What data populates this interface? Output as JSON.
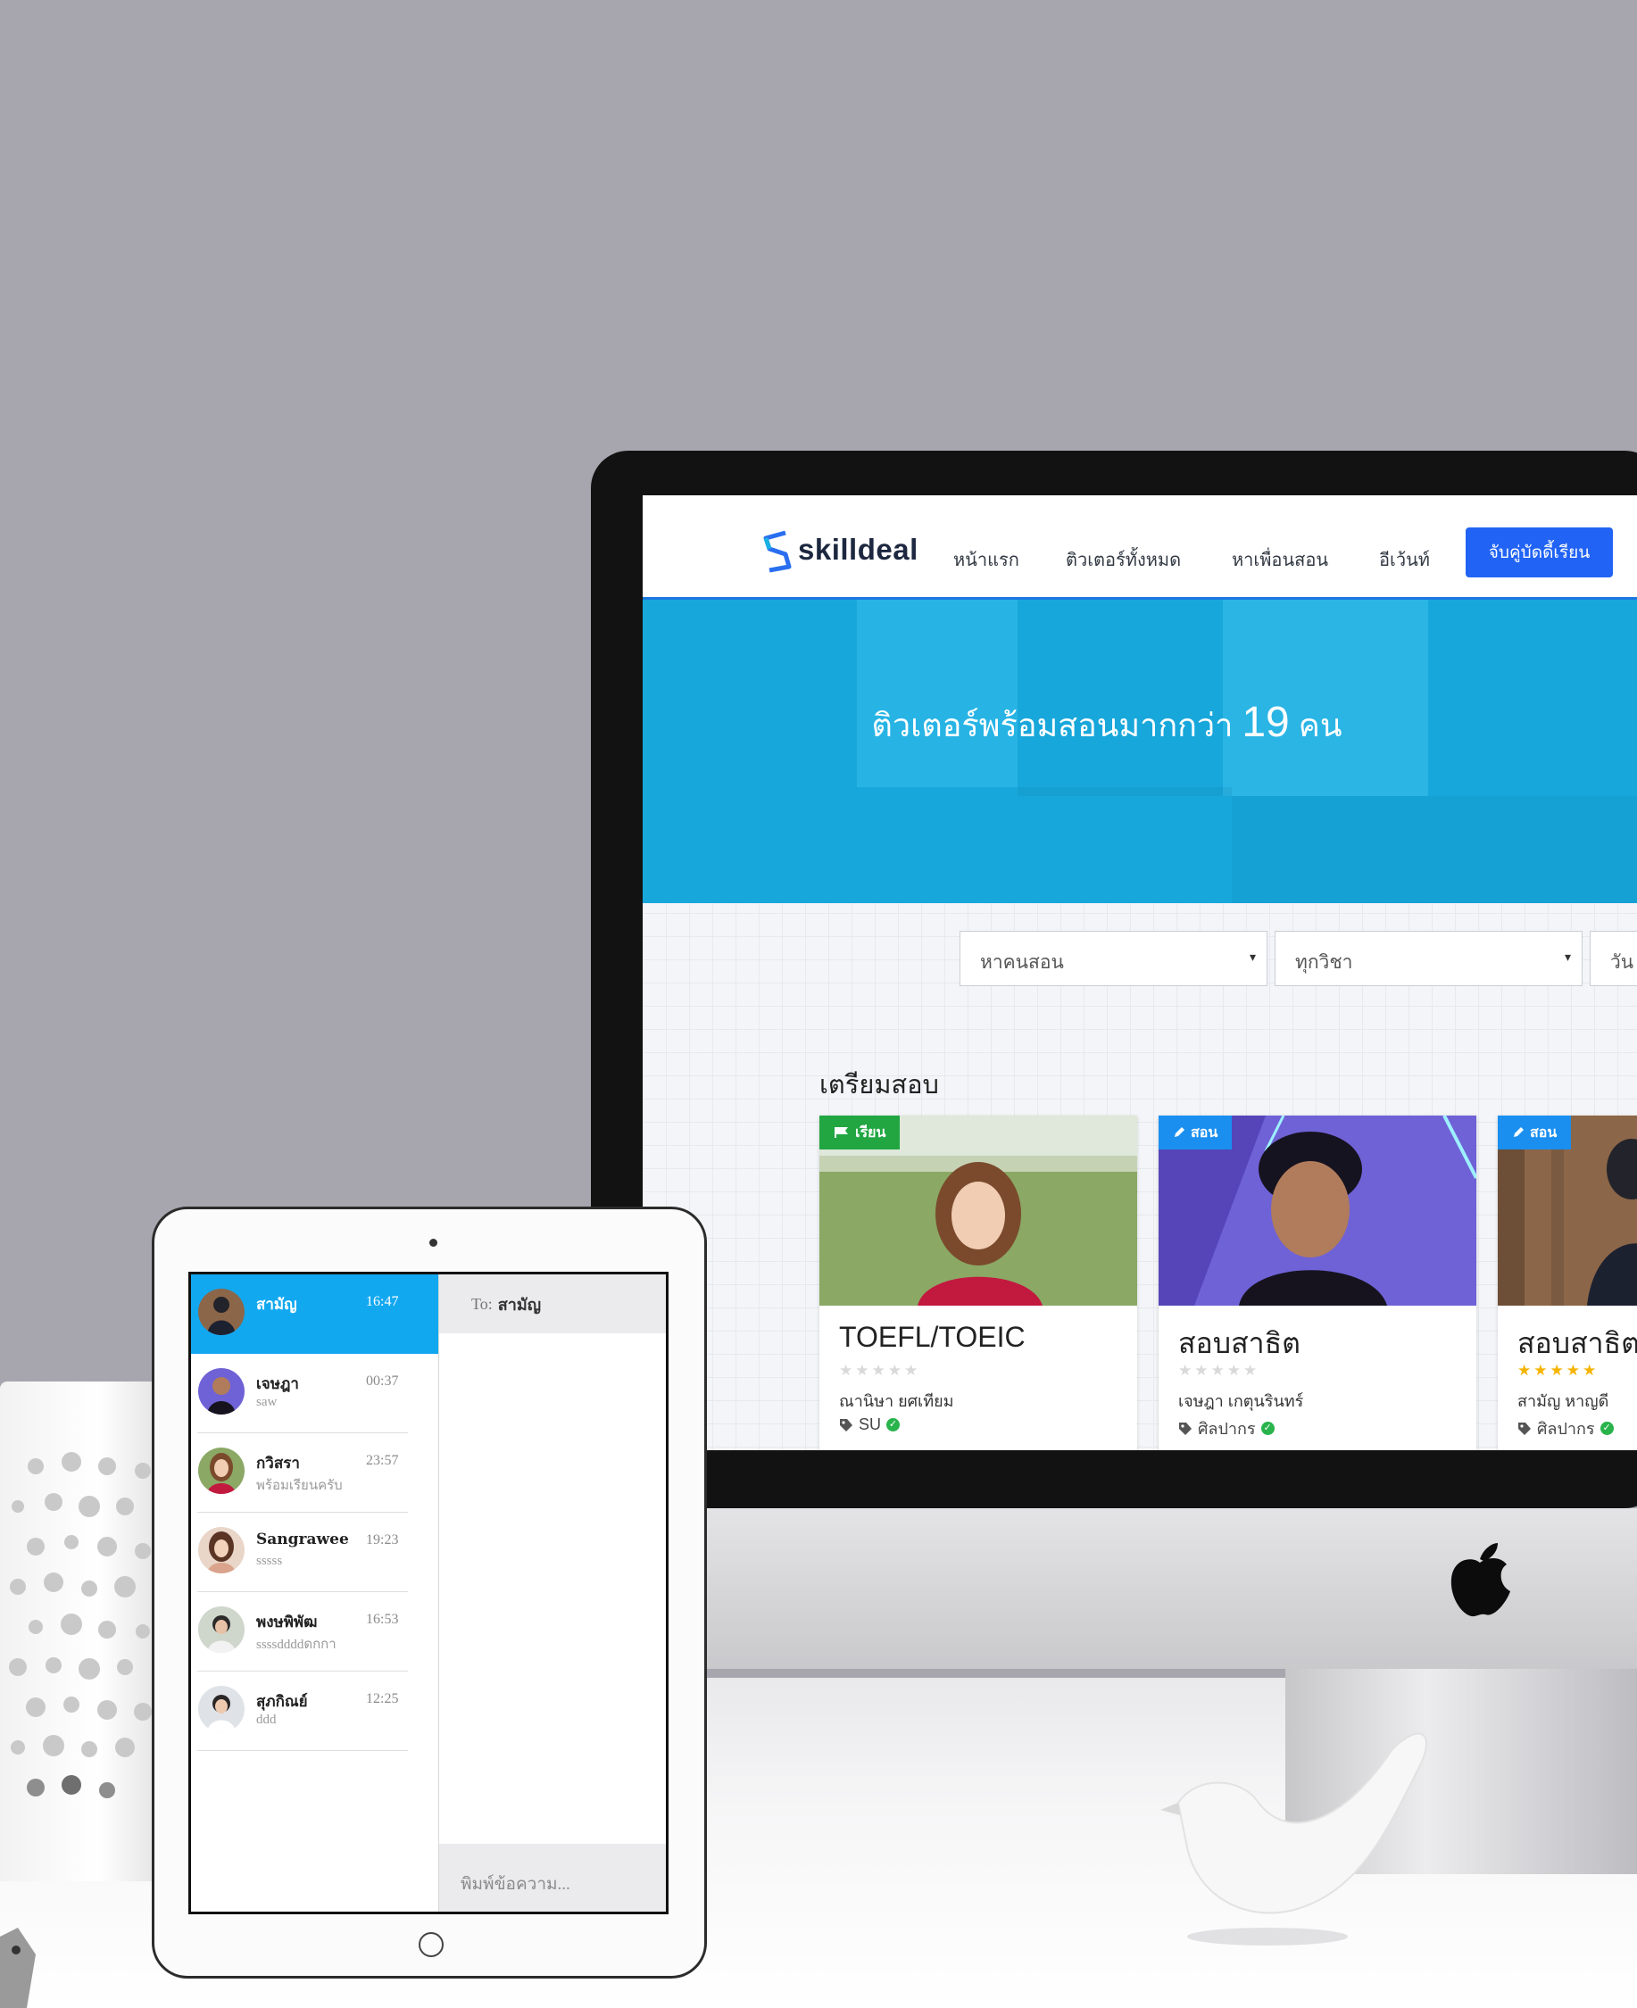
{
  "site": {
    "brand": "skilldeal",
    "nav": [
      "หน้าแรก",
      "ติวเตอร์ทั้งหมด",
      "หาเพื่อนสอน",
      "อีเว้นท์"
    ],
    "cta": "จับคู่บัดดี้เรียน",
    "hero": {
      "prefix": "ติวเตอร์พร้อมสอนมากกว่า ",
      "count": "19",
      "suffix": " คน"
    },
    "filters": [
      {
        "value": "หาคนสอน",
        "caret": "▾"
      },
      {
        "value": "ทุกวิชา",
        "caret": "▾"
      },
      {
        "value": "วัน",
        "caret": ""
      }
    ],
    "section_title": "เตรียมสอบ",
    "cards": [
      {
        "badge": "เรียน",
        "badge_icon": "flag-icon",
        "badge_color": "#21a642",
        "title": "TOEFL/TOEIC",
        "stars": "★★★★★",
        "rating": 0,
        "tutor": "ณานิษา ยศเทียม",
        "university": "SU",
        "verified": "✓"
      },
      {
        "badge": "สอน",
        "badge_icon": "pencil-icon",
        "badge_color": "#1a8ff0",
        "title": "สอบสาธิต",
        "stars": "★★★★★",
        "rating": 0,
        "tutor": "เจษฎา เกตุนรินทร์",
        "university": "ศิลปากร",
        "verified": "✓"
      },
      {
        "badge": "สอน",
        "badge_icon": "pencil-icon",
        "badge_color": "#1a8ff0",
        "title": "สอบสาธิต",
        "stars": "★★★★★",
        "rating": 5,
        "tutor": "สามัญ หาญดี",
        "university": "ศิลปากร",
        "verified": "✓"
      }
    ]
  },
  "chat": {
    "conversations": [
      {
        "name": "สามัญ",
        "time": "16:47",
        "preview": "",
        "active": true
      },
      {
        "name": "เจษฎา",
        "time": "00:37",
        "preview": "saw",
        "active": false
      },
      {
        "name": "กวิสรา",
        "time": "23:57",
        "preview": "พร้อมเรียนครับ",
        "active": false
      },
      {
        "name": "Sangrawee",
        "time": "19:23",
        "preview": "sssss",
        "active": false
      },
      {
        "name": "พงษพิพัฒ",
        "time": "16:53",
        "preview": "ssssddddดกกา",
        "active": false
      },
      {
        "name": "สุภกิณย์",
        "time": "12:25",
        "preview": "ddd",
        "active": false
      }
    ],
    "to_label": "To:",
    "to_name": "สามัญ",
    "input_placeholder": "พิมพ์ข้อความ..."
  },
  "colors": {
    "accent": "#2163f4",
    "hero": "#1ab0e4",
    "chat_active": "#12a8f0",
    "learn_badge": "#21a642",
    "teach_badge": "#1a8ff0"
  }
}
